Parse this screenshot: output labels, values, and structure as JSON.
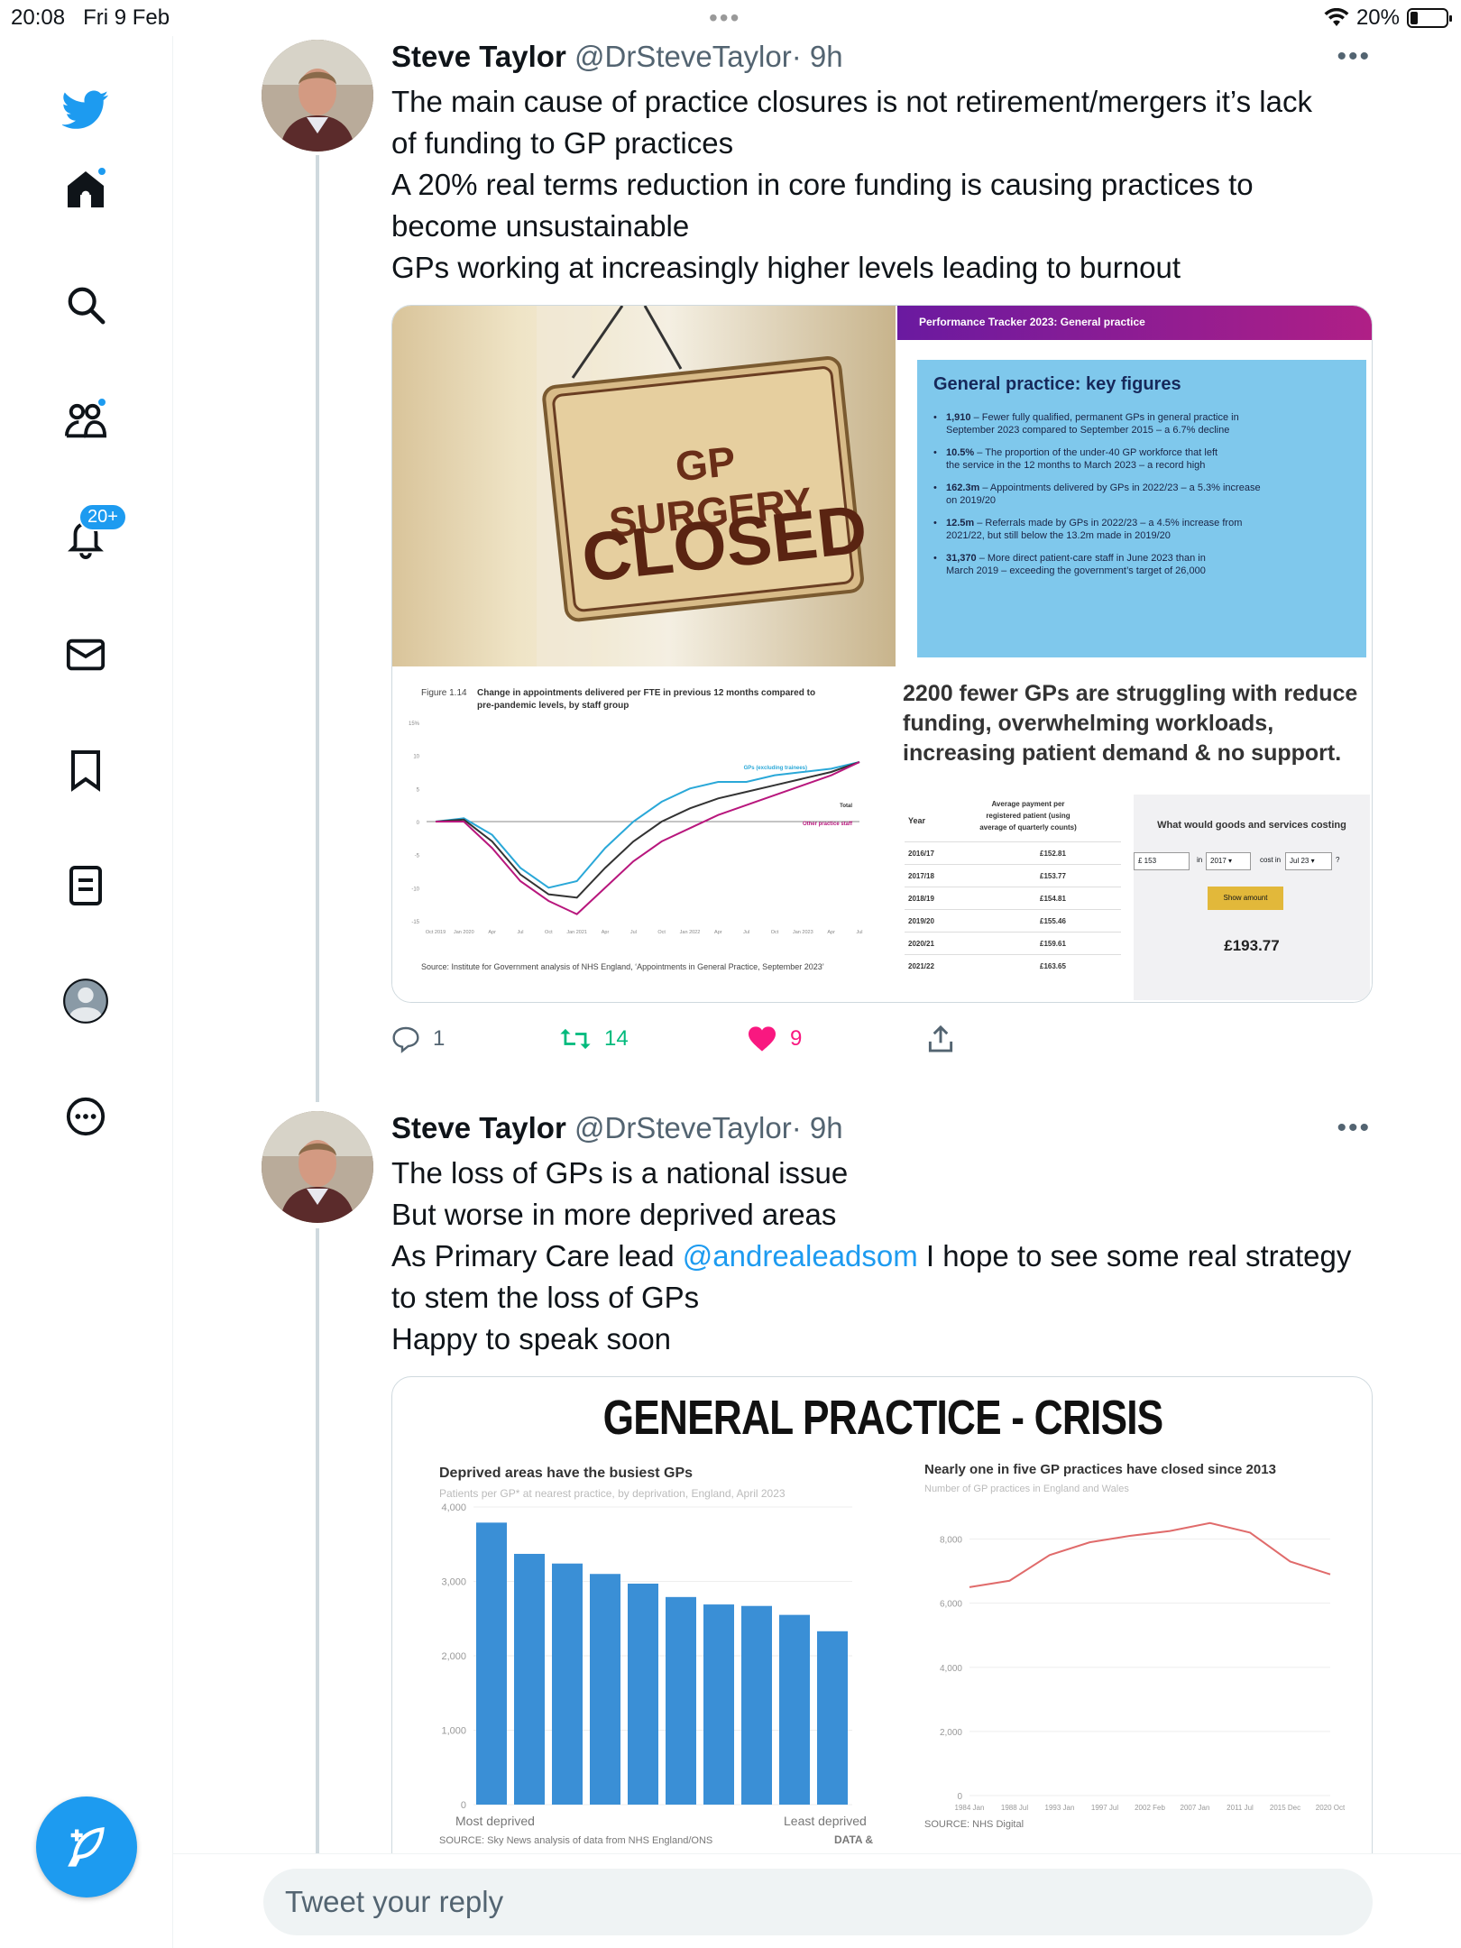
{
  "status": {
    "time": "20:08",
    "date": "Fri 9 Feb",
    "battery": "20%",
    "battery_level": 0.2
  },
  "sidebar": {
    "notifications_badge": "20+"
  },
  "tweets": [
    {
      "name": "Steve Taylor",
      "handle": "@DrSteveTaylor",
      "time": "· 9h",
      "lines": [
        "The main cause of practice closures is not retirement/mergers it’s lack",
        "of funding to GP practices",
        "A 20% real terms reduction in core funding is causing practices to",
        "become unsustainable",
        "GPs working at increasingly higher levels leading to burnout"
      ],
      "replies": "1",
      "retweets": "14",
      "likes": "9"
    },
    {
      "name": "Steve Taylor",
      "handle": "@DrSteveTaylor",
      "time": "· 9h",
      "lines": [
        "The loss of GPs is a national issue",
        "But worse in more deprived areas"
      ],
      "line3_prefix": "As Primary Care lead ",
      "mention": "@andrealeadsom",
      "line3_suffix": " I hope to see some real strategy",
      "lines_after": [
        "to stem the loss of GPs",
        "Happy to speak soon"
      ]
    }
  ],
  "media1": {
    "sign_line1": "GP SURGERY",
    "sign_line2": "CLOSED",
    "tracker_header": "Performance Tracker 2023: General practice",
    "key_title": "General practice: key figures",
    "key_figures": [
      {
        "bold": "1,910",
        "text": " – Fewer fully qualified, permanent GPs in general practice in",
        "text2": "September 2023 compared to September 2015 – a 6.7% decline"
      },
      {
        "bold": "10.5%",
        "text": " – The proportion of the under-40 GP workforce that left",
        "text2": "the service in the 12 months to March 2023 – a record high"
      },
      {
        "bold": "162.3m",
        "text": " – Appointments delivered by GPs in 2022/23 – a 5.3% increase",
        "text2": "on 2019/20"
      },
      {
        "bold": "12.5m",
        "text": " – Referrals made by GPs in 2022/23 – a 4.5% increase from",
        "text2": "2021/22, but still below the 13.2m made in 2019/20"
      },
      {
        "bold": "31,370",
        "text": " – More direct patient-care staff in June 2023 than in",
        "text2": "March 2019 – exceeding the government’s target of 26,000"
      }
    ],
    "figure_label": "Figure 1.14",
    "figure_title1": "Change in appointments delivered per FTE in previous 12 months compared to",
    "figure_title2": "pre-pandemic levels, by staff group",
    "figure_source": "Source: Institute for Government analysis of NHS England, ‘Appointments in General Practice, September 2023’",
    "legend_gps": "GPs (excluding trainees)",
    "legend_total": "Total",
    "legend_other": "Other practice staff",
    "headline": [
      "2200 fewer GPs are struggling with reduce",
      "funding, overwhelming workloads,",
      "increasing patient demand & no support."
    ],
    "table_year_header": "Year",
    "table_payment_header": [
      "Average payment per",
      "registered patient (using",
      "average of quarterly counts)"
    ],
    "table_rows": [
      [
        "2016/17",
        "£152.81"
      ],
      [
        "2017/18",
        "£153.77"
      ],
      [
        "2018/19",
        "£154.81"
      ],
      [
        "2019/20",
        "£155.46"
      ],
      [
        "2020/21",
        "£159.61"
      ],
      [
        "2021/22",
        "£163.65"
      ]
    ],
    "calc_title": "What would goods and services costing",
    "calc_amount": "£ 153",
    "calc_in": "in",
    "calc_year": "2017",
    "calc_cost_in": "cost in",
    "calc_month": "Jul 23",
    "calc_q": "?",
    "calc_button": "Show amount",
    "calc_result": "£193.77"
  },
  "media2": {
    "title": "GENERAL PRACTICE - CRISIS",
    "left_title": "Deprived areas have the busiest GPs",
    "left_subtitle": "Patients per GP* at nearest practice, by deprivation, England, April 2023",
    "left_x_start": "Most deprived",
    "left_x_end": "Least deprived",
    "left_source": "SOURCE: Sky News analysis of data from NHS England/ONS",
    "left_brand": "DATA &",
    "right_title": "Nearly one in five GP practices have closed since 2013",
    "right_subtitle": "Number of GP practices in England and Wales",
    "right_source": "SOURCE: NHS Digital"
  },
  "chart_data": [
    {
      "type": "line",
      "title": "Change in appointments delivered per FTE in previous 12 months compared to pre-pandemic levels, by staff group",
      "x": [
        "Oct 2019",
        "Jan 2020",
        "Apr",
        "Jul",
        "Oct",
        "Jan 2021",
        "Apr",
        "Jul",
        "Oct",
        "Jan 2022",
        "Apr",
        "Jul",
        "Oct",
        "Jan 2023",
        "Apr",
        "Jul"
      ],
      "ylim": [
        -15,
        15
      ],
      "yticks": [
        "15%",
        "10",
        "5",
        "0",
        "-5",
        "-10",
        "-15"
      ],
      "series": [
        {
          "name": "GPs (excluding trainees)",
          "color": "#2aa8d8",
          "values": [
            0,
            0.5,
            -2,
            -7,
            -10,
            -9,
            -4,
            0,
            3,
            5,
            6,
            6,
            7,
            7.5,
            8,
            9
          ]
        },
        {
          "name": "Total",
          "color": "#333333",
          "values": [
            0,
            0.3,
            -3,
            -8,
            -11,
            -11.5,
            -7,
            -3,
            0,
            2,
            3.5,
            4.5,
            5.5,
            6.5,
            7.5,
            9
          ]
        },
        {
          "name": "Other practice staff",
          "color": "#b8177d",
          "values": [
            0,
            0,
            -4,
            -9,
            -12,
            -14,
            -10,
            -6,
            -3,
            -1,
            1,
            2.5,
            4,
            5.5,
            7,
            9
          ]
        }
      ]
    },
    {
      "type": "bar",
      "title": "Deprived areas have the busiest GPs",
      "categories": [
        "1",
        "2",
        "3",
        "4",
        "5",
        "6",
        "7",
        "8",
        "9",
        "10"
      ],
      "values": [
        3790,
        3370,
        3240,
        3100,
        2970,
        2790,
        2690,
        2670,
        2550,
        2330
      ],
      "yticks": [
        "4,000",
        "3,000",
        "2,000",
        "1,000",
        "0"
      ],
      "ylim": [
        0,
        4000
      ],
      "color": "#3a8fd6"
    },
    {
      "type": "line",
      "title": "Nearly one in five GP practices have closed since 2013",
      "x": [
        "1984 Jan",
        "1988 Jul",
        "1993 Jan",
        "1997 Jul",
        "2002 Feb",
        "2007 Jan",
        "2011 Jul",
        "2015 Dec",
        "2020 Oct"
      ],
      "yticks": [
        "8,000",
        "6,000",
        "4,000",
        "2,000",
        "0"
      ],
      "ylim": [
        0,
        9000
      ],
      "series": [
        {
          "color": "#e06b6b",
          "values": [
            6500,
            6700,
            7500,
            7900,
            8100,
            8250,
            8500,
            8200,
            7300,
            6900
          ]
        }
      ]
    }
  ]
}
